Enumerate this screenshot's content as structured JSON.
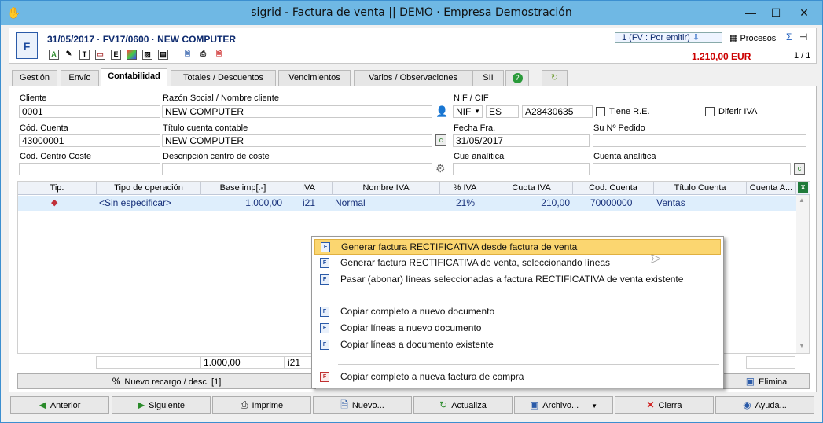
{
  "window": {
    "title": "sigrid - Factura de venta || DEMO · Empresa Demostración",
    "minimize": "—",
    "maximize": "☐",
    "close": "✕"
  },
  "header": {
    "doc_title": "31/05/2017 · FV17/0600 · NEW COMPUTER",
    "status": "1 (FV : Por emitir)",
    "procesos": "Procesos",
    "total": "1.210,00 EUR",
    "pager": "1 / 1"
  },
  "tabs": [
    "Gestión",
    "Envío",
    "Contabilidad",
    "Totales / Descuentos",
    "Vencimientos",
    "Varios / Observaciones",
    "SII"
  ],
  "form": {
    "cliente_label": "Cliente",
    "cliente": "0001",
    "razon_label": "Razón Social / Nombre cliente",
    "razon": "NEW COMPUTER",
    "nif_label": "NIF / CIF",
    "nif_type": "NIF",
    "nif_country": "ES",
    "nif": "A28430635",
    "tiene_re": "Tiene R.E.",
    "diferir_iva": "Diferir IVA",
    "cod_cuenta_label": "Cód. Cuenta",
    "cod_cuenta": "43000001",
    "titulo_label": "Título cuenta contable",
    "titulo": "NEW COMPUTER",
    "fecha_label": "Fecha Fra.",
    "fecha": "31/05/2017",
    "pedido_label": "Su Nº Pedido",
    "pedido": "",
    "centro_label": "Cód. Centro Coste",
    "centro": "",
    "desc_centro_label": "Descripción centro de coste",
    "desc_centro": "",
    "cue_label": "Cue analítica",
    "cue": "",
    "cuenta_analitica_label": "Cuenta analítica",
    "cuenta_analitica": ""
  },
  "grid": {
    "columns": [
      "Tip.",
      "Tipo de operación",
      "Base imp[.-]",
      "IVA",
      "Nombre IVA",
      "% IVA",
      "Cuota IVA",
      "Cod. Cuenta",
      "Título Cuenta",
      "Cuenta A..."
    ],
    "row": {
      "tipo": "<Sin especificar>",
      "base": "1.000,00",
      "iva": "i21",
      "nombre": "Normal",
      "pct": "21%",
      "cuota": "210,00",
      "cuenta": "70000000",
      "titulo": "Ventas"
    },
    "footer": {
      "base": "1.000,00",
      "iva": "i21"
    }
  },
  "actions": {
    "nuevo_recargo": "Nuevo recargo / desc. [1]",
    "elimina": "Elimina"
  },
  "buttons": [
    "Anterior",
    "Siguiente",
    "Imprime",
    "Nuevo...",
    "Actualiza",
    "Archivo...",
    "Cierra",
    "Ayuda..."
  ],
  "context_menu": [
    "Generar factura RECTIFICATIVA desde factura de venta",
    "Generar factura RECTIFICATIVA de venta, seleccionando líneas",
    "Pasar (abonar) líneas seleccionadas a factura RECTIFICATIVA de venta existente",
    "Copiar completo a nuevo documento",
    "Copiar líneas a nuevo documento",
    "Copiar líneas a documento existente",
    "Copiar completo a nueva factura de compra"
  ]
}
